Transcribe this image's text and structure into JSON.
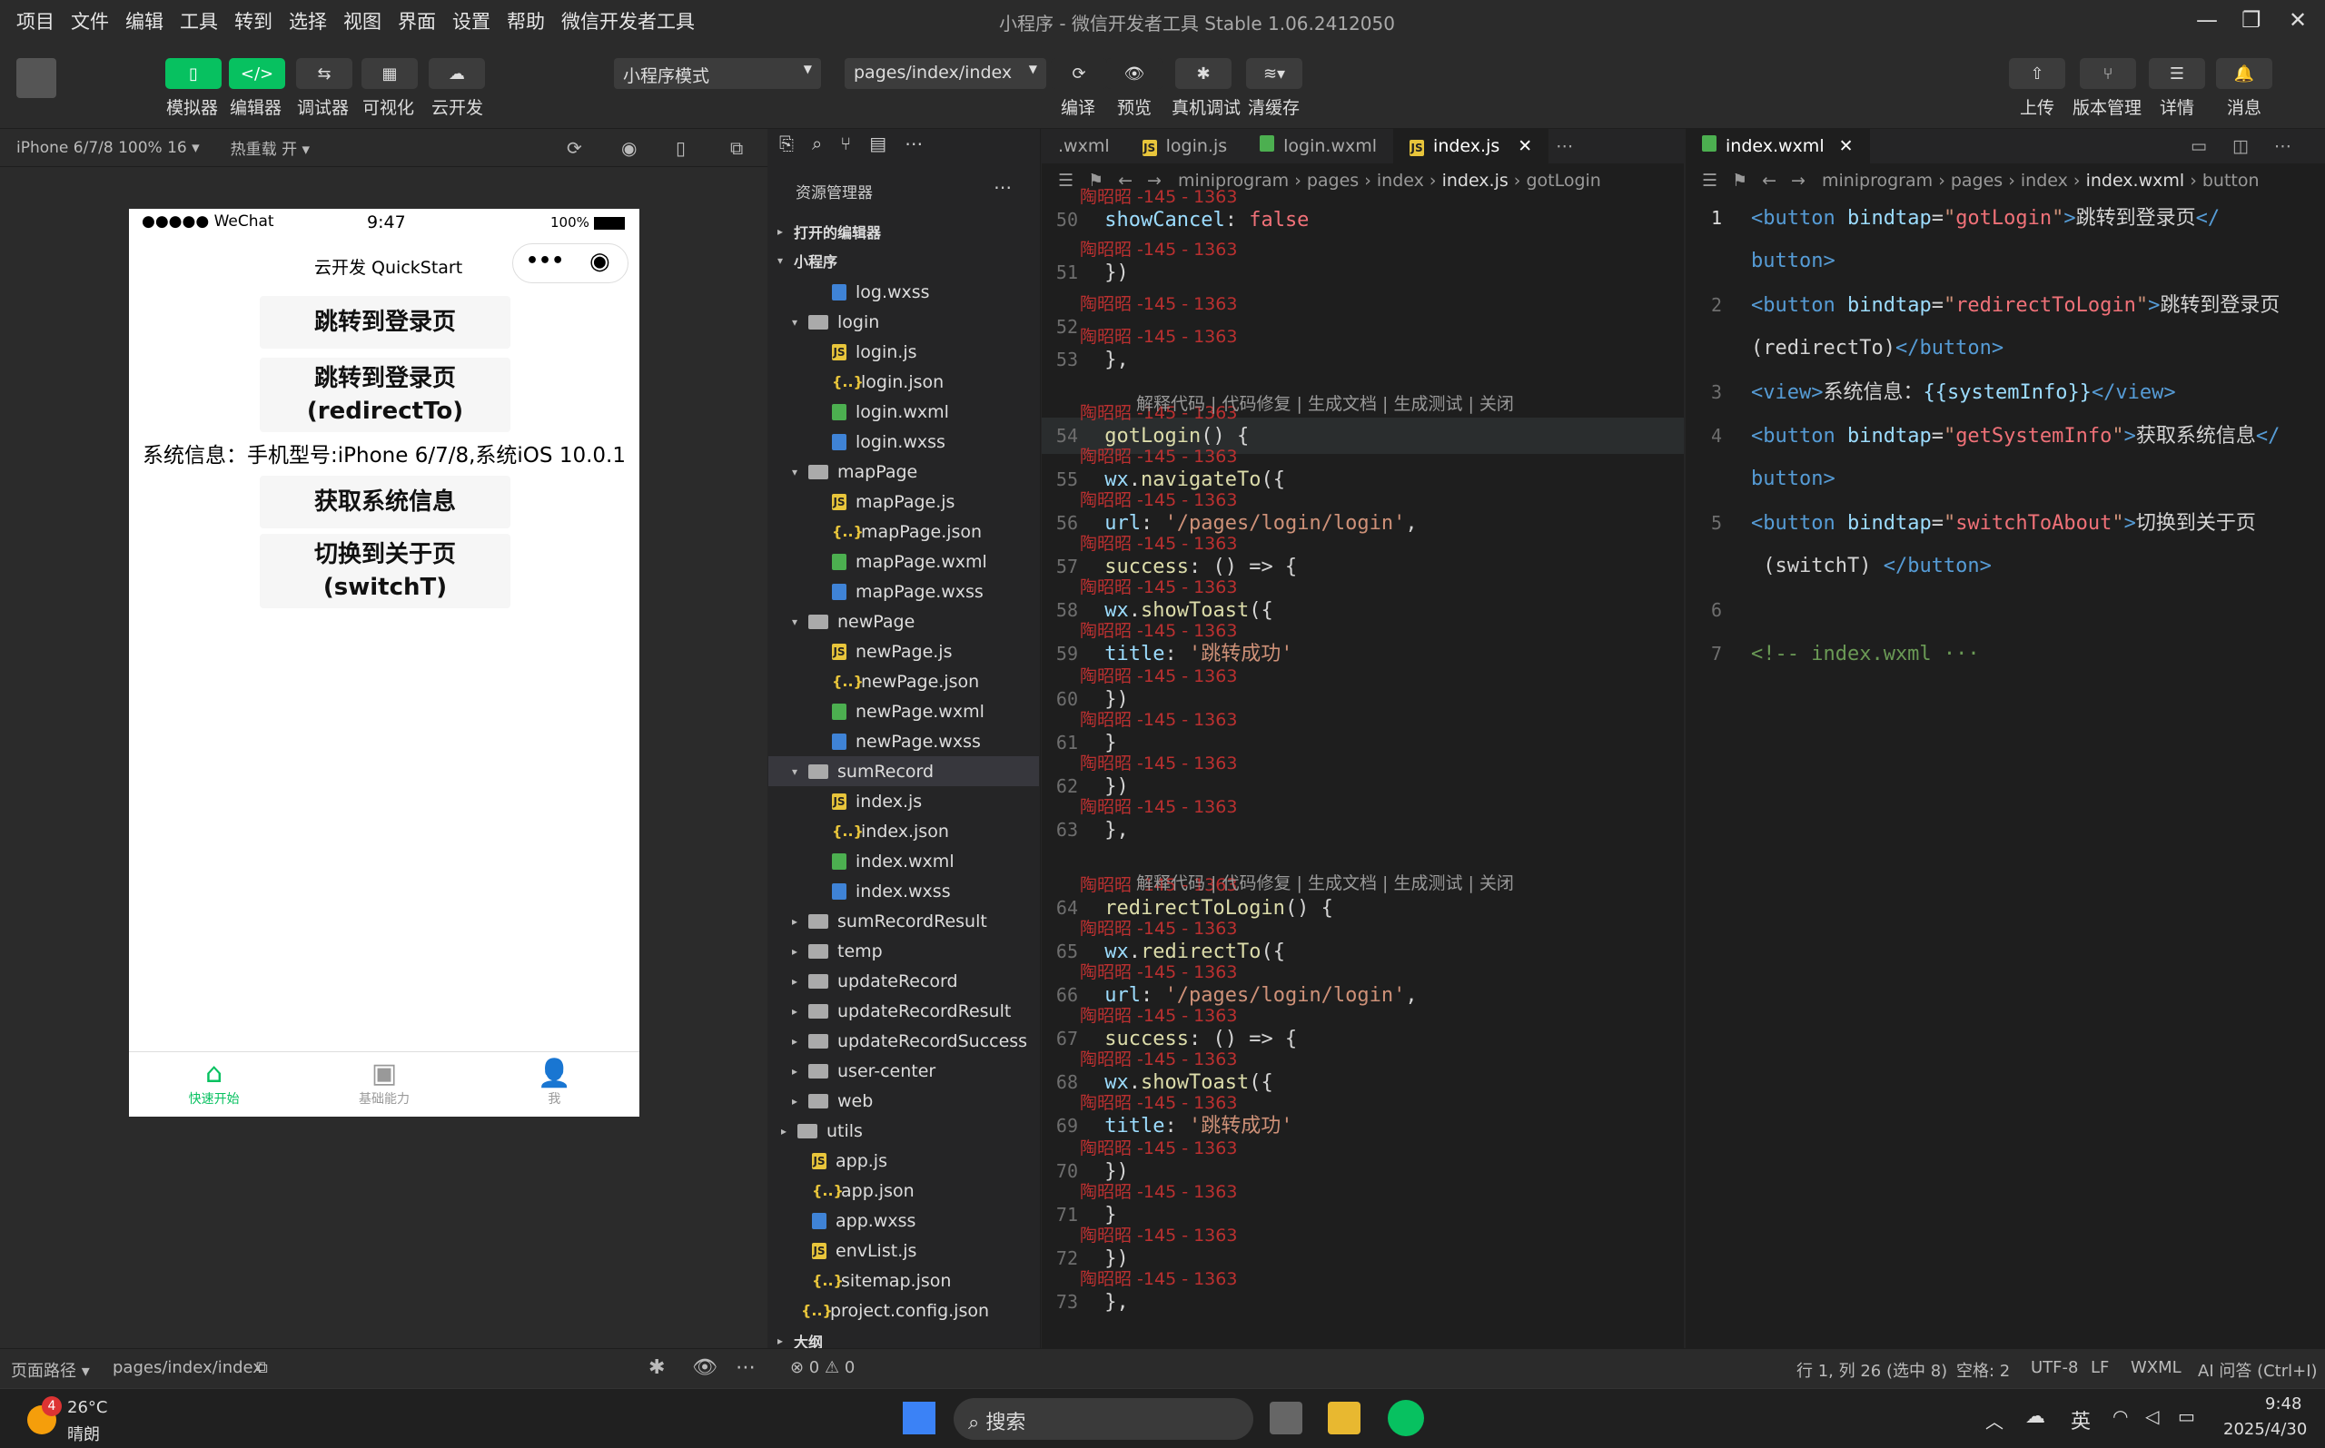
{
  "menu": [
    "项目",
    "文件",
    "编辑",
    "工具",
    "转到",
    "选择",
    "视图",
    "界面",
    "设置",
    "帮助",
    "微信开发者工具"
  ],
  "window_title": "小程序 - 微信开发者工具 Stable 1.06.2412050",
  "toolbar": {
    "simulator": "模拟器",
    "editor": "编辑器",
    "debugger": "调试器",
    "visual": "可视化",
    "cloud": "云开发",
    "mode": "小程序模式",
    "page": "pages/index/index",
    "compile": "编译",
    "preview": "预览",
    "remote_debug": "真机调试",
    "clear_cache": "清缓存",
    "upload": "上传",
    "version": "版本管理",
    "details": "详情",
    "messages": "消息"
  },
  "sim": {
    "device": "iPhone 6/7/8 100% 16 ▾",
    "hot_reload": "热重载 开 ▾",
    "carrier": "●●●●● WeChat",
    "time": "9:47",
    "battery": "100%",
    "nav_title": "云开发 QuickStart",
    "btn1": "跳转到登录页",
    "btn2a": "跳转到登录页",
    "btn2b": "(redirectTo)",
    "sysinfo": "系统信息：手机型号:iPhone 6/7/8,系统iOS 10.0.1",
    "btn3": "获取系统信息",
    "btn4a": "切换到关于页",
    "btn4b": "(switchT)",
    "tab1": "快速开始",
    "tab2": "基础能力",
    "tab3": "我"
  },
  "explorer": {
    "title": "资源管理器",
    "open_editors": "打开的编辑器",
    "project": "小程序",
    "outline": "大纲",
    "items": [
      "log.wxss",
      "login",
      "login.js",
      "login.json",
      "login.wxml",
      "login.wxss",
      "mapPage",
      "mapPage.js",
      "mapPage.json",
      "mapPage.wxml",
      "mapPage.wxss",
      "newPage",
      "newPage.js",
      "newPage.json",
      "newPage.wxml",
      "newPage.wxss",
      "sumRecord",
      "index.js",
      "index.json",
      "index.wxml",
      "index.wxss",
      "sumRecordResult",
      "temp",
      "updateRecord",
      "updateRecordResult",
      "updateRecordSuccess",
      "user-center",
      "web",
      "utils",
      "app.js",
      "app.json",
      "app.wxss",
      "envList.js",
      "sitemap.json",
      "project.config.json"
    ]
  },
  "editor1": {
    "tabs": [
      ".wxml",
      "login.js",
      "login.wxml",
      "index.js"
    ],
    "crumb": [
      "miniprogram",
      "pages",
      "index",
      "index.js",
      "gotLogin"
    ],
    "lens": "解释代码 | 代码修复 | 生成文档 | 生成测试 | 关闭",
    "watermark": "陶昭昭 -145 - 1363",
    "lines": [
      "50",
      "51",
      "52",
      "53",
      "54",
      "55",
      "56",
      "57",
      "58",
      "59",
      "60",
      "61",
      "62",
      "63",
      "64",
      "65",
      "66",
      "67",
      "68",
      "69",
      "70",
      "71",
      "72",
      "73"
    ]
  },
  "editor2": {
    "tab": "index.wxml",
    "crumb": [
      "miniprogram",
      "pages",
      "index",
      "index.wxml",
      "button"
    ]
  },
  "status": {
    "path_label": "页面路径 ▾",
    "path": "pages/index/index",
    "errors": "⊗ 0 ⚠ 0",
    "cursor": "行 1, 列 26 (选中 8)",
    "spaces": "空格: 2",
    "encoding": "UTF-8",
    "eol": "LF",
    "lang": "WXML",
    "ai": "AI 问答 (Ctrl+I)"
  },
  "taskbar": {
    "temp": "26°C",
    "weather": "晴朗",
    "badge": "4",
    "search": "搜索",
    "lang": "英",
    "time": "9:48",
    "date": "2025/4/30"
  }
}
